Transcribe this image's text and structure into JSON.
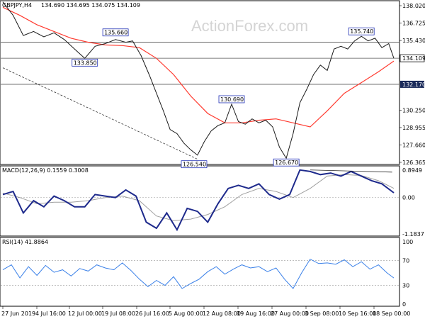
{
  "header": {
    "symbol": "GBPJPY,H4",
    "ohlc": "134.690 134.695 134.075 134.109"
  },
  "watermark": "ActionForex.com",
  "colors": {
    "price": "#1a1a1a",
    "ema": "#ff3b30",
    "macd": "#1e2a8c",
    "signal": "#a0a0a0",
    "rsi": "#3a80e8",
    "label_border": "#1f2fb5",
    "current_tag": "#1a2a5a"
  },
  "chart_data": [
    {
      "type": "line",
      "name": "price",
      "title": "GBPJPY,H4",
      "ylim": [
        126.365,
        138.02
      ],
      "yticks": [
        "138.020",
        "136.725",
        "135.430",
        "134.109",
        "132.170",
        "130.250",
        "128.955",
        "127.660",
        "126.365"
      ],
      "x": [
        "27 Jun 2019",
        "4 Jul 16:00",
        "12 Jul 00:00",
        "19 Jul 08:00",
        "26 Jul 16:00",
        "5 Aug 00:00",
        "12 Aug 08:00",
        "19 Aug 16:00",
        "27 Aug 00:00",
        "3 Sep 08:00",
        "10 Sep 16:00",
        "18 Sep 00:00"
      ],
      "series": [
        {
          "role": "close",
          "x": [
            0,
            0.3,
            0.6,
            0.9,
            1.2,
            1.5,
            1.8,
            2.1,
            2.4,
            2.7,
            3,
            3.3,
            3.6,
            3.8,
            4.05,
            4.3,
            4.5,
            4.7,
            4.9,
            5.1,
            5.3,
            5.5,
            5.7,
            5.9,
            6.1,
            6.3,
            6.5,
            6.7,
            6.9,
            7.1,
            7.3,
            7.5,
            7.7,
            7.9,
            8.1,
            8.3,
            8.5,
            8.7,
            8.9,
            9.1,
            9.3,
            9.5,
            9.7,
            9.9,
            10.1,
            10.3,
            10.5,
            10.7,
            10.9,
            11.1,
            11.3,
            11.45
          ],
          "values": [
            138.3,
            137.3,
            135.8,
            136.1,
            135.7,
            136.0,
            135.5,
            134.8,
            134.1,
            135.0,
            135.2,
            135.5,
            135.3,
            135.4,
            134.3,
            132.8,
            131.5,
            130.2,
            128.8,
            128.5,
            127.8,
            127.3,
            126.9,
            127.9,
            128.7,
            129.1,
            129.3,
            130.69,
            129.4,
            129.2,
            129.6,
            129.3,
            129.5,
            129.0,
            127.5,
            126.67,
            128.5,
            130.8,
            131.8,
            132.9,
            133.6,
            133.2,
            134.8,
            135.0,
            134.8,
            135.4,
            135.74,
            135.4,
            135.6,
            134.9,
            135.2,
            134.109
          ]
        },
        {
          "role": "ema",
          "name": "",
          "x": [
            0,
            0.5,
            1,
            1.5,
            2,
            2.5,
            3,
            3.5,
            4,
            4.5,
            5,
            5.5,
            6,
            6.5,
            7,
            7.5,
            8,
            8.5,
            9,
            9.5,
            10,
            10.5,
            11,
            11.45
          ],
          "values": [
            137.9,
            137.3,
            136.6,
            136.1,
            135.6,
            135.3,
            135.1,
            135.05,
            134.9,
            134.1,
            132.9,
            131.3,
            130.0,
            129.3,
            129.3,
            129.5,
            129.6,
            129.3,
            129.0,
            130.2,
            131.5,
            132.3,
            133.1,
            133.9
          ]
        }
      ],
      "annotations": [
        {
          "label": "135.660",
          "x": 3.3,
          "y": 135.66
        },
        {
          "label": "133.850",
          "x": 2.4,
          "y": 134.1
        },
        {
          "label": "126.540",
          "x": 5.6,
          "y": 126.54
        },
        {
          "label": "130.690",
          "x": 6.7,
          "y": 130.69
        },
        {
          "label": "126.670",
          "x": 8.3,
          "y": 126.67
        },
        {
          "label": "135.740",
          "x": 10.5,
          "y": 135.74
        }
      ],
      "hlines": [
        135.3,
        134.109,
        132.17
      ],
      "trendline": [
        [
          0,
          133.4
        ],
        [
          5.7,
          126.6
        ]
      ],
      "current_price": "134.109",
      "support_price": "132.170"
    },
    {
      "type": "line",
      "name": "macd",
      "title": "MACD(12,26,9) 0.1559 0.3008",
      "ylim": [
        -1.1837,
        0.8949
      ],
      "yticks": [
        "0.8949",
        "0.00",
        "-1.1837"
      ],
      "series": [
        {
          "role": "macd",
          "x": [
            0,
            0.3,
            0.6,
            0.9,
            1.2,
            1.5,
            1.8,
            2.1,
            2.4,
            2.7,
            3,
            3.3,
            3.6,
            3.9,
            4.2,
            4.5,
            4.8,
            5.1,
            5.4,
            5.7,
            6,
            6.3,
            6.6,
            6.9,
            7.2,
            7.5,
            7.8,
            8.1,
            8.4,
            8.7,
            9,
            9.3,
            9.6,
            9.9,
            10.2,
            10.5,
            10.8,
            11.1,
            11.45
          ],
          "values": [
            0.1,
            0.2,
            -0.5,
            -0.1,
            -0.3,
            0.05,
            -0.1,
            -0.3,
            -0.3,
            0.1,
            0.05,
            0.0,
            0.25,
            0.05,
            -0.8,
            -1.0,
            -0.5,
            -1.05,
            -0.35,
            -0.45,
            -0.8,
            -0.2,
            0.3,
            0.4,
            0.3,
            0.45,
            0.1,
            -0.05,
            0.1,
            0.9,
            0.85,
            0.75,
            0.8,
            0.7,
            0.85,
            0.7,
            0.55,
            0.45,
            0.1559
          ]
        },
        {
          "role": "signal",
          "x": [
            0,
            0.5,
            1,
            1.5,
            2,
            2.5,
            3,
            3.5,
            4,
            4.5,
            5,
            5.5,
            6,
            6.5,
            7,
            7.5,
            8,
            8.5,
            9,
            9.5,
            10,
            10.5,
            11,
            11.45
          ],
          "values": [
            0.15,
            0.0,
            -0.2,
            -0.15,
            -0.15,
            -0.1,
            0.0,
            0.05,
            -0.1,
            -0.6,
            -0.75,
            -0.7,
            -0.55,
            -0.3,
            0.1,
            0.3,
            0.2,
            0.0,
            0.3,
            0.7,
            0.75,
            0.72,
            0.55,
            0.3008
          ]
        }
      ],
      "zero_line": 0,
      "trendline": [
        [
          9,
          0.9
        ],
        [
          11.4,
          0.83
        ]
      ]
    },
    {
      "type": "line",
      "name": "rsi",
      "title": "RSI(14) 41.8864",
      "ylim": [
        0,
        100
      ],
      "yticks": [
        "100",
        "70",
        "30",
        "0"
      ],
      "levels": [
        70,
        30
      ],
      "series": [
        {
          "role": "rsi",
          "x": [
            0,
            0.25,
            0.5,
            0.75,
            1,
            1.25,
            1.5,
            1.75,
            2,
            2.25,
            2.5,
            2.75,
            3,
            3.25,
            3.5,
            3.75,
            4,
            4.25,
            4.5,
            4.75,
            5,
            5.25,
            5.5,
            5.75,
            6,
            6.25,
            6.5,
            6.75,
            7,
            7.25,
            7.5,
            7.75,
            8,
            8.25,
            8.5,
            8.75,
            9,
            9.25,
            9.5,
            9.75,
            10,
            10.25,
            10.5,
            10.75,
            11,
            11.25,
            11.45
          ],
          "values": [
            55,
            63,
            42,
            60,
            46,
            62,
            51,
            55,
            45,
            57,
            53,
            63,
            58,
            55,
            66,
            54,
            40,
            28,
            38,
            30,
            44,
            25,
            33,
            40,
            52,
            60,
            48,
            56,
            63,
            58,
            60,
            52,
            58,
            40,
            25,
            50,
            72,
            65,
            66,
            64,
            71,
            60,
            68,
            56,
            63,
            50,
            41.8864
          ]
        }
      ]
    }
  ]
}
